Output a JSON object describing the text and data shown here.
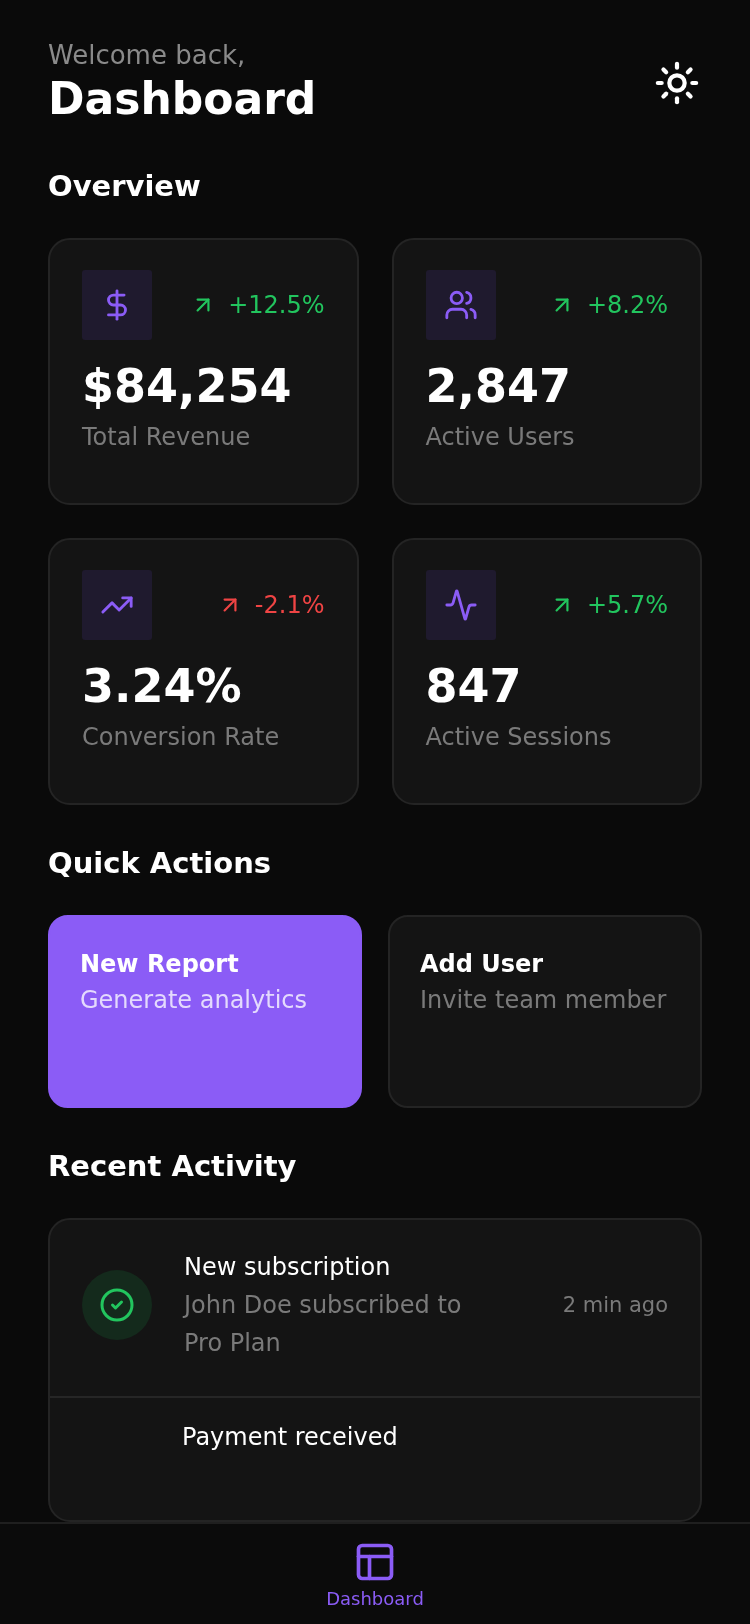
{
  "header": {
    "greeting": "Welcome back,",
    "title": "Dashboard"
  },
  "overview": {
    "title": "Overview",
    "stats": [
      {
        "trend": "+12.5%",
        "color": "#22c55e",
        "value": "$84,254",
        "label": "Total Revenue"
      },
      {
        "trend": "+8.2%",
        "color": "#22c55e",
        "value": "2,847",
        "label": "Active Users"
      },
      {
        "trend": "-2.1%",
        "color": "#ef4444",
        "value": "3.24%",
        "label": "Conversion Rate"
      },
      {
        "trend": "+5.7%",
        "color": "#22c55e",
        "value": "847",
        "label": "Active Sessions"
      }
    ]
  },
  "quick_actions": {
    "title": "Quick Actions",
    "actions": [
      {
        "kind": "primary",
        "title": "New Report",
        "subtitle": "Generate analytics"
      },
      {
        "kind": "secondary",
        "title": "Add User",
        "subtitle": "Invite team member"
      }
    ]
  },
  "recent_activity": {
    "title": "Recent Activity",
    "items": [
      {
        "title": "New subscription",
        "subtitle": "John Doe subscribed to Pro Plan",
        "time": "2 min ago"
      },
      {
        "title": "Payment received"
      }
    ]
  },
  "tab_bar": [
    {
      "label": "Dashboard",
      "selected": true
    }
  ]
}
